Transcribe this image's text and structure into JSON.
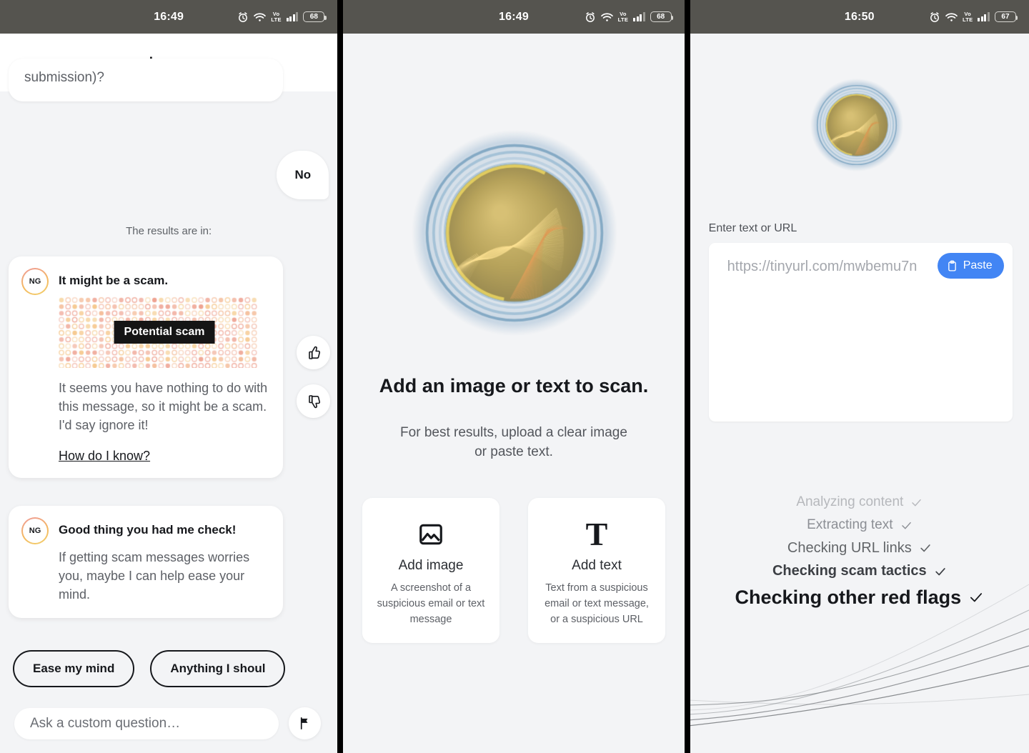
{
  "theme": {
    "statusbar_bg": "#55544f",
    "page_bg": "#f3f4f6",
    "card_bg": "#ffffff",
    "text_primary": "#16181c",
    "text_secondary": "#5d6066",
    "accent_blue": "#4285f4",
    "badge_bg": "#151515"
  },
  "panel1": {
    "statusbar": {
      "time": "16:49",
      "battery": "68",
      "network": "VoLTE",
      "icons": [
        "alarm-icon",
        "wifi-icon",
        "volte-icon",
        "signal-icon",
        "battery-icon"
      ]
    },
    "header": {
      "title": "Image"
    },
    "incoming_partial": {
      "text": "submission)?"
    },
    "outgoing": {
      "text": "No"
    },
    "results_label": "The results are in:",
    "cards": [
      {
        "avatar": "NG",
        "title": "It might be a scam.",
        "image_badge": "Potential scam",
        "body": "It seems you have nothing to do with this message, so it might be a scam. I'd say ignore it!",
        "link": "How do I know?"
      },
      {
        "avatar": "NG",
        "title": "Good thing you had me check!",
        "body": "If getting scam messages worries you, maybe I can help ease your mind."
      }
    ],
    "feedback": {
      "thumbs_up": "thumbs-up-icon",
      "thumbs_down": "thumbs-down-icon"
    },
    "chips": [
      "Ease my mind",
      "Anything I shoul"
    ],
    "composer": {
      "placeholder": "Ask a custom question…",
      "action_icon": "flag-icon"
    }
  },
  "panel2": {
    "statusbar": {
      "time": "16:49",
      "battery": "68",
      "network": "VoLTE",
      "icons": [
        "alarm-icon",
        "wifi-icon",
        "volte-icon",
        "signal-icon",
        "battery-icon"
      ]
    },
    "hero": {
      "orb": "scam-detector-orb",
      "title": "Add an image or text to scan.",
      "subtitle": "For best results, upload a clear image or paste text."
    },
    "options": [
      {
        "icon": "image-icon",
        "name": "Add image",
        "desc": "A screenshot of a suspicious email or text message"
      },
      {
        "icon": "text-icon",
        "name": "Add text",
        "desc": "Text from a suspicious email or text message, or a suspicious URL"
      }
    ]
  },
  "panel3": {
    "statusbar": {
      "time": "16:50",
      "battery": "67",
      "network": "VoLTE",
      "icons": [
        "alarm-icon",
        "wifi-icon",
        "volte-icon",
        "signal-icon",
        "battery-icon"
      ]
    },
    "orb": "scam-detector-orb",
    "field": {
      "label": "Enter text or URL",
      "placeholder": "https://tinyurl.com/mwbemu7n",
      "value": "",
      "paste_button": {
        "label": "Paste",
        "icon": "clipboard-icon"
      }
    },
    "progress_steps": [
      {
        "label": "Analyzing content",
        "state": "done",
        "check": "check-icon"
      },
      {
        "label": "Extracting text",
        "state": "done",
        "check": "check-icon"
      },
      {
        "label": "Checking URL links",
        "state": "done",
        "check": "check-icon"
      },
      {
        "label": "Checking scam tactics",
        "state": "done",
        "check": "check-icon"
      },
      {
        "label": "Checking other red flags",
        "state": "active",
        "check": "check-icon"
      }
    ]
  }
}
